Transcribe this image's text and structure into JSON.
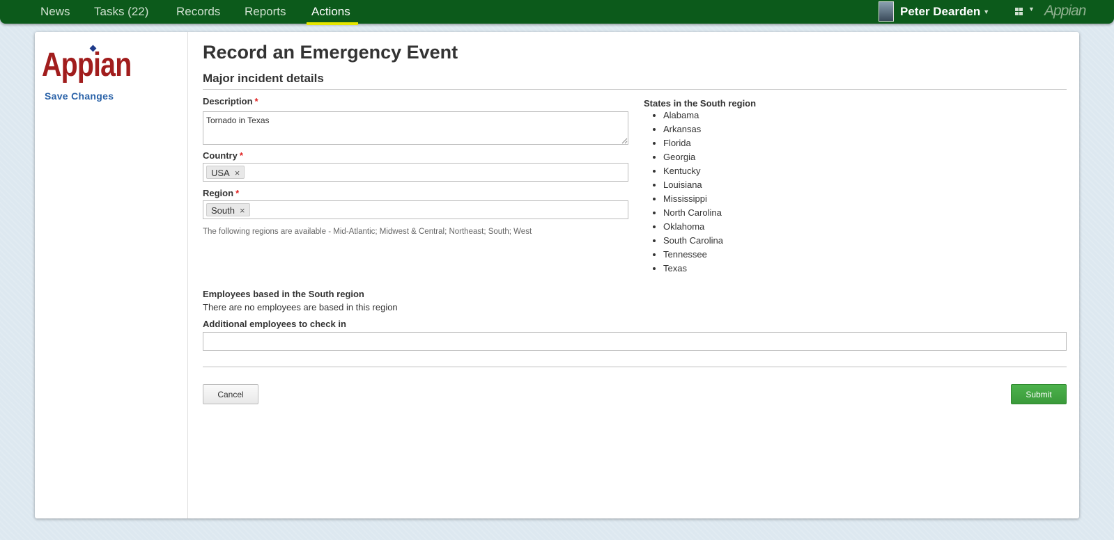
{
  "nav": {
    "tabs": [
      {
        "label": "News"
      },
      {
        "label": "Tasks (22)"
      },
      {
        "label": "Records"
      },
      {
        "label": "Reports"
      },
      {
        "label": "Actions",
        "active": true
      }
    ],
    "user_name": "Peter Dearden",
    "brand": "Appian"
  },
  "sidebar": {
    "logo_text": "Appian",
    "save_link": "Save Changes"
  },
  "form": {
    "title": "Record an Emergency Event",
    "section_title": "Major incident details",
    "description": {
      "label": "Description",
      "required_marker": "*",
      "value": "Tornado in Texas"
    },
    "country": {
      "label": "Country",
      "required_marker": "*",
      "token": "USA"
    },
    "region": {
      "label": "Region",
      "required_marker": "*",
      "token": "South",
      "help": "The following regions are available - Mid-Atlantic; Midwest & Central; Northeast; South; West"
    },
    "states": {
      "label": "States in the South region",
      "items": [
        "Alabama",
        "Arkansas",
        "Florida",
        "Georgia",
        "Kentucky",
        "Louisiana",
        "Mississippi",
        "North Carolina",
        "Oklahoma",
        "South Carolina",
        "Tennessee",
        "Texas"
      ]
    },
    "employees": {
      "label": "Employees based in the South region",
      "text": "There are no employees are based in this region"
    },
    "additional": {
      "label": "Additional employees to check in",
      "value": ""
    },
    "buttons": {
      "cancel": "Cancel",
      "submit": "Submit"
    }
  },
  "colors": {
    "topbar": "#0c5a1b",
    "accent_underline": "#e6e600",
    "submit": "#3ea73e",
    "logo": "#a11d1d",
    "link": "#2a62a8",
    "required": "#e02020"
  }
}
